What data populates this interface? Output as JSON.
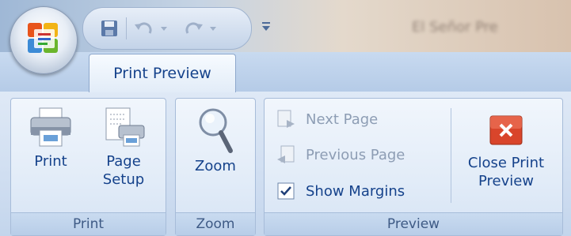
{
  "titlebar": {
    "document_title": "El Señor Pre"
  },
  "tab": {
    "active_label": "Print Preview"
  },
  "groups": {
    "print": {
      "label": "Print",
      "print_button": "Print",
      "page_setup_button": "Page Setup"
    },
    "zoom": {
      "label": "Zoom",
      "zoom_button": "Zoom"
    },
    "preview": {
      "label": "Preview",
      "next_page": "Next Page",
      "previous_page": "Previous Page",
      "show_margins": "Show Margins",
      "show_margins_checked": true,
      "close_button": "Close Print Preview"
    }
  },
  "icons": {
    "office": "office-logo-icon",
    "save": "save-icon",
    "undo": "undo-icon",
    "redo": "redo-icon",
    "customize": "customize-qat-icon",
    "print": "printer-icon",
    "page_setup": "page-setup-icon",
    "zoom": "magnifier-icon",
    "next_page": "next-page-icon",
    "previous_page": "previous-page-icon",
    "close": "close-red-icon"
  },
  "colors": {
    "accent_text": "#15428b",
    "disabled_text": "#8d9db4",
    "close_red": "#d9452b"
  }
}
